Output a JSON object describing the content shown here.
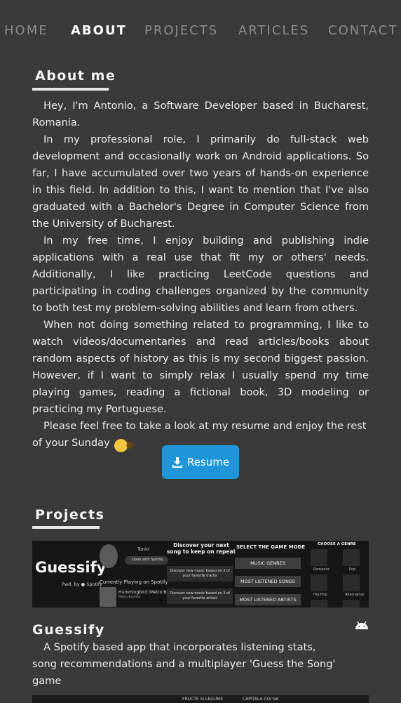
{
  "nav": {
    "items": [
      "HOME",
      "ABOUT",
      "PROJECTS",
      "ARTICLES",
      "CONTACT"
    ],
    "active": "ABOUT"
  },
  "about": {
    "title": "About me",
    "paragraphs": [
      "Hey, I'm Antonio, a Software Developer based in Bucharest, Romania.",
      "In my professional role, I primarily do full-stack web development and occasionally work on Android applications. So far, I have accumulated over two years of hands-on experience in this field. In addition to this, I want to mention that I've also graduated with a Bachelor's Degree in Computer Science from the University of Bucharest.",
      "In my free time, I enjoy building and publishing indie applications with a real use that fit my or others' needs. Additionally, I like practicing LeetCode questions and participating in coding challenges organized by the community to both test my problem-solving abilities and learn from others.",
      "When not doing something related to programming, I like to watch videos/documentaries and read articles/books about random aspects of history as this is my second biggest passion. However, if I want to simply relax I usually spend my time playing games, reading a fictional book, 3D modeling or practicing my Portuguese.",
      "Please feel free to take a look at my resume and enjoy the rest of your Sunday"
    ],
    "emoji": "grinning-face-emoji",
    "resume_label": "Resume",
    "resume_icon": "download-icon"
  },
  "projects": {
    "title": "Projects",
    "items": [
      {
        "name": "Guessify",
        "platform_icon": "android-icon",
        "description": "A Spotify based app that incorporates listening stats, song recommendations and a multiplayer 'Guess the Song' game",
        "banner": {
          "logo": "Guessify",
          "powered_by": "Pwd. by",
          "spotify": "Spotify",
          "user": "Tonio",
          "open_spotify": "Open with Spotify",
          "currently_playing": "Currently Playing on Spotify",
          "track": "Hummingbird (Metro Boom",
          "track_artist": "Metro Boomin",
          "discover_title": "Discover your next song to keep on repeat",
          "discover_1": "Discover new music based on 3 of your favorite tracks",
          "discover_2": "Discover new music based on 3 of your favorite artists",
          "game_mode_title": "SELECT THE GAME MODE",
          "game_modes": [
            "MUSIC GENRES",
            "MOST LISTENED SONGS",
            "MOST LISTENED ARTISTS"
          ],
          "genre_title": "CHOOSE A GENRE",
          "genres": [
            "Romance",
            "Pop",
            "Hip-Hop",
            "Alternative"
          ]
        }
      }
    ],
    "next_banner_texts": [
      "FRUCTE SI LEGUME",
      "CAPITALA CUI NA"
    ]
  },
  "colors": {
    "background": "#3a3a3a",
    "accent": "#1e96d9",
    "nav_inactive": "#8d8d8d",
    "android_green_shown_as": "#ffffff"
  }
}
